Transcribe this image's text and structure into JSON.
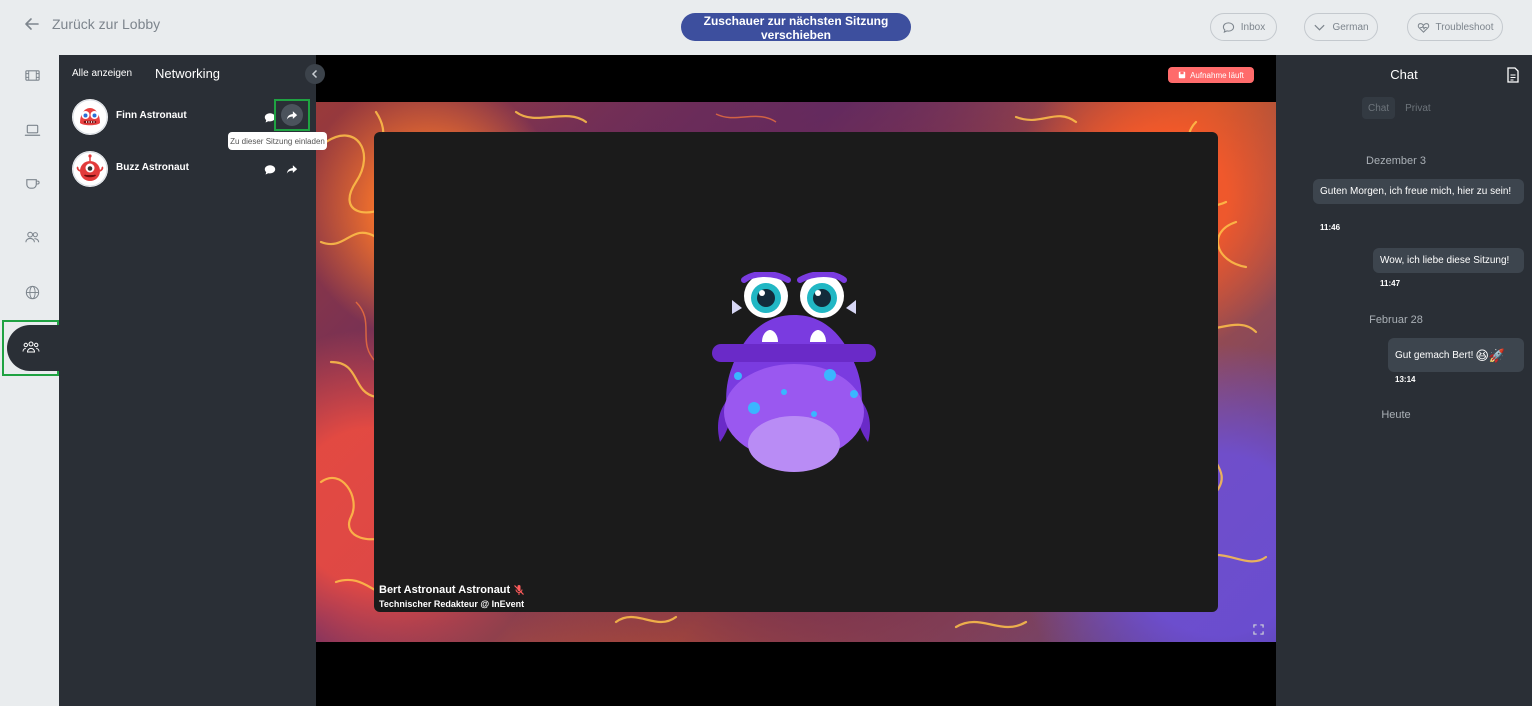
{
  "topbar": {
    "back_label": "Zurück zur Lobby",
    "move_viewers_label": "Zuschauer zur nächsten Sitzung verschieben",
    "inbox_label": "Inbox",
    "language_label": "German",
    "troubleshoot_label": "Troubleshoot"
  },
  "rail": {
    "items": [
      "film-icon",
      "laptop-icon",
      "coffee-icon",
      "people-icon",
      "globe-icon",
      "networking-icon"
    ],
    "active": "networking-icon"
  },
  "networking": {
    "tab_all_label": "Alle anzeigen",
    "title": "Networking",
    "people": [
      {
        "name": "Finn Astronaut"
      },
      {
        "name": "Buzz Astronaut"
      }
    ],
    "invite_tooltip": "Zu dieser Sitzung einladen"
  },
  "stage": {
    "recording_label": "Aufnahme läuft",
    "speaker_name": "Bert Astronaut Astronaut",
    "speaker_role": "Technischer Redakteur @ InEvent"
  },
  "chat": {
    "title": "Chat",
    "tabs": [
      "Chat",
      "Privat"
    ],
    "active_tab": "Chat",
    "messages": [
      {
        "date": "Dezember 3"
      },
      {
        "text": "Guten Morgen, ich freue mich, hier zu sein!",
        "time": "11:46"
      },
      {
        "text": "Wow, ich liebe diese Sitzung!",
        "time": "11:47"
      },
      {
        "date": "Februar 28"
      },
      {
        "text": "Gut gemach Bert!",
        "emoji": "😆🚀",
        "time": "13:14"
      },
      {
        "date": "Heute"
      }
    ]
  },
  "colors": {
    "primary": "#3d4f9e",
    "panel_bg": "#2a2f36",
    "highlight": "#1fa242",
    "recording": "#ff6b6b"
  }
}
